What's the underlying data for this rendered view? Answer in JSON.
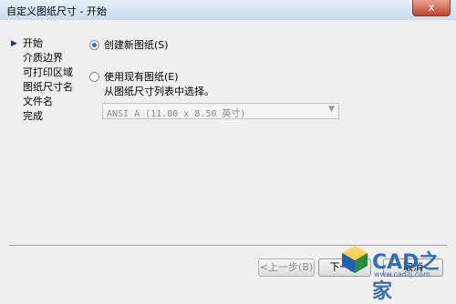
{
  "window": {
    "title": "自定义图纸尺寸 - 开始",
    "close_label": "x"
  },
  "nav": {
    "items": [
      {
        "label": "开始",
        "current": true
      },
      {
        "label": "介质边界"
      },
      {
        "label": "可打印区域"
      },
      {
        "label": "图纸尺寸名"
      },
      {
        "label": "文件名"
      },
      {
        "label": "完成"
      }
    ]
  },
  "options": {
    "create_new": {
      "label": "创建新图纸(S)",
      "selected": true
    },
    "use_existing": {
      "label": "使用现有图纸(E)",
      "selected": false
    },
    "hint": "从图纸尺寸列表中选择。",
    "paper_select": {
      "value": "ANSI A (11.00 x 8.50 英寸)"
    }
  },
  "buttons": {
    "back": "<上一步(B)",
    "next": "下一步",
    "cancel": "取消"
  },
  "watermark": {
    "text": "CAD之家",
    "url": "www.cadzj.com"
  },
  "colors": {
    "accent": "#2b6cc4",
    "title_bg": "#c9dcef"
  }
}
